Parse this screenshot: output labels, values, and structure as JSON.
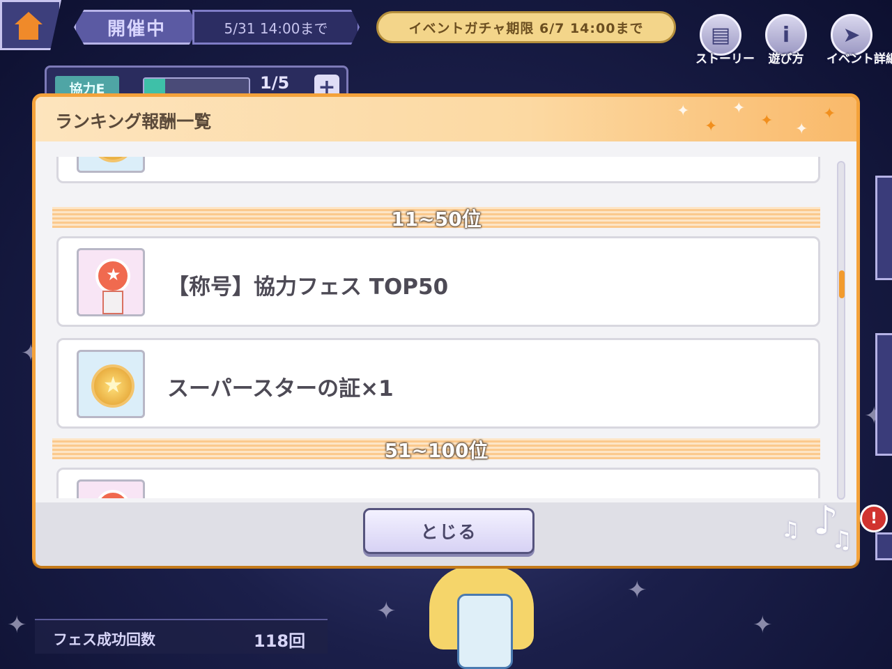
{
  "header": {
    "status_label": "開催中",
    "status_date": "5/31 14:00まで",
    "gacha_notice": "イベントガチャ期限 6/7 14:00まで",
    "buttons": [
      {
        "label": "ストーリー",
        "icon": "book-icon"
      },
      {
        "label": "遊び方",
        "icon": "info-icon"
      },
      {
        "label": "イベント詳細",
        "icon": "paper-plane-icon"
      }
    ]
  },
  "coop": {
    "label": "協力E",
    "count": "1/5",
    "gauge_fraction": 0.2
  },
  "modal": {
    "title": "ランキング報酬一覧",
    "ranks": [
      {
        "label": "11~50位",
        "rewards": [
          {
            "text": "【称号】協力フェス TOP50",
            "icon": "title-rosette-icon"
          },
          {
            "text": "スーパースターの証×1",
            "icon": "superstar-medal-icon"
          }
        ]
      },
      {
        "label": "51~100位",
        "rewards": [
          {
            "text": "",
            "icon": "title-rosette-icon"
          }
        ]
      }
    ],
    "close_label": "とじる",
    "scroll_fraction": 0.35
  },
  "footer": {
    "fes_success_label": "フェス成功回数",
    "fes_success_value": "118回"
  },
  "colors": {
    "accent_orange": "#f4a23a",
    "gacha_gold": "#f3d58a",
    "alert_red": "#d1332f"
  }
}
